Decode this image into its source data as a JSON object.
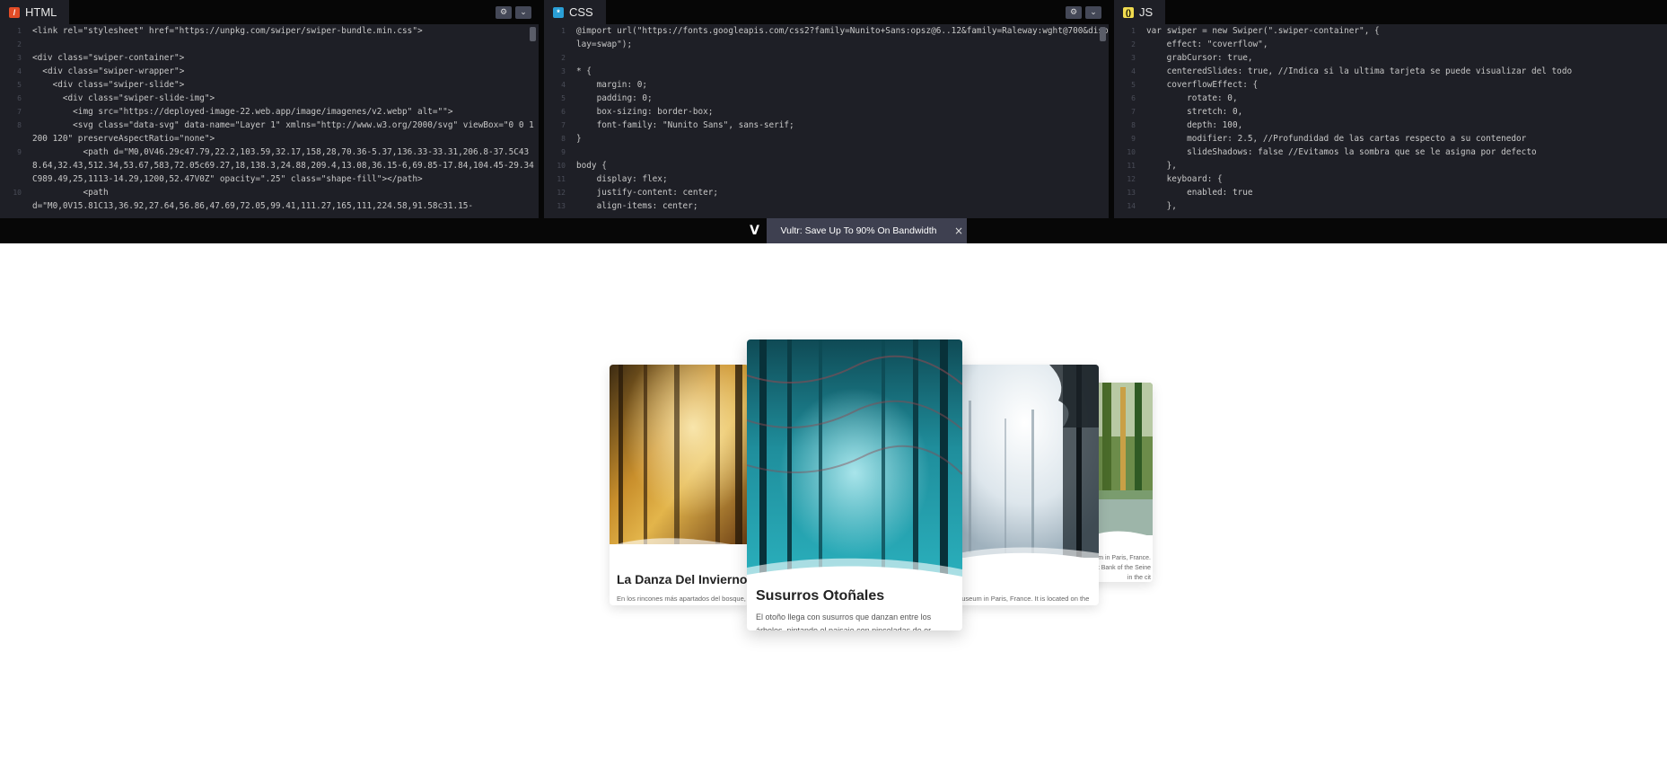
{
  "html_panel": {
    "tab_label": "HTML",
    "icon": "html-icon",
    "lines": [
      {
        "n": "1",
        "t": "<link rel=\"stylesheet\" href=\"https://unpkg.com/swiper/swiper-bundle.min.css\">"
      },
      {
        "n": "2",
        "t": ""
      },
      {
        "n": "3",
        "t": "<div class=\"swiper-container\">"
      },
      {
        "n": "4",
        "t": "  <div class=\"swiper-wrapper\">"
      },
      {
        "n": "5",
        "t": "    <div class=\"swiper-slide\">"
      },
      {
        "n": "6",
        "t": "      <div class=\"swiper-slide-img\">"
      },
      {
        "n": "7",
        "t": "        <img src=\"https://deployed-image-22.web.app/image/imagenes/v2.webp\" alt=\"\">"
      },
      {
        "n": "8",
        "t": "        <svg class=\"data-svg\" data-name=\"Layer 1\" xmlns=\"http://www.w3.org/2000/svg\" viewBox=\"0 0 1200 120\" preserveAspectRatio=\"none\">"
      },
      {
        "n": "9",
        "t": "          <path d=\"M0,0V46.29c47.79,22.2,103.59,32.17,158,28,70.36-5.37,136.33-33.31,206.8-37.5C438.64,32.43,512.34,53.67,583,72.05c69.27,18,138.3,24.88,209.4,13.08,36.15-6,69.85-17.84,104.45-29.34C989.49,25,1113-14.29,1200,52.47V0Z\" opacity=\".25\" class=\"shape-fill\"></path>"
      },
      {
        "n": "10",
        "t": "          <path"
      },
      {
        "n": "",
        "t": "d=\"M0,0V15.81C13,36.92,27.64,56.86,47.69,72.05,99.41,111.27,165,111,224.58,91.58c31.15-"
      }
    ]
  },
  "css_panel": {
    "tab_label": "CSS",
    "icon": "css-icon",
    "lines": [
      {
        "n": "1",
        "t": "@import url(\"https://fonts.googleapis.com/css2?family=Nunito+Sans:opsz@6..12&family=Raleway:wght@700&display=swap\");"
      },
      {
        "n": "2",
        "t": ""
      },
      {
        "n": "3",
        "t": "* {"
      },
      {
        "n": "4",
        "t": "    margin: 0;"
      },
      {
        "n": "5",
        "t": "    padding: 0;"
      },
      {
        "n": "6",
        "t": "    box-sizing: border-box;"
      },
      {
        "n": "7",
        "t": "    font-family: \"Nunito Sans\", sans-serif;"
      },
      {
        "n": "8",
        "t": "}"
      },
      {
        "n": "9",
        "t": ""
      },
      {
        "n": "10",
        "t": "body {"
      },
      {
        "n": "11",
        "t": "    display: flex;"
      },
      {
        "n": "12",
        "t": "    justify-content: center;"
      },
      {
        "n": "13",
        "t": "    align-items: center;"
      }
    ]
  },
  "js_panel": {
    "tab_label": "JS",
    "icon": "js-icon",
    "lines": [
      {
        "n": "1",
        "t": "var swiper = new Swiper(\".swiper-container\", {"
      },
      {
        "n": "2",
        "t": "    effect: \"coverflow\","
      },
      {
        "n": "3",
        "t": "    grabCursor: true,"
      },
      {
        "n": "4",
        "t": "    centeredSlides: true, //Indica si la ultima tarjeta se puede visualizar del todo"
      },
      {
        "n": "5",
        "t": "    coverflowEffect: {"
      },
      {
        "n": "6",
        "t": "        rotate: 0,"
      },
      {
        "n": "7",
        "t": "        stretch: 0,"
      },
      {
        "n": "8",
        "t": "        depth: 100,"
      },
      {
        "n": "9",
        "t": "        modifier: 2.5, //Profundidad de las cartas respecto a su contenedor"
      },
      {
        "n": "10",
        "t": "        slideShadows: false //Evitamos la sombra que se le asigna por defecto"
      },
      {
        "n": "11",
        "t": "    },"
      },
      {
        "n": "12",
        "t": "    keyboard: {"
      },
      {
        "n": "13",
        "t": "        enabled: true"
      },
      {
        "n": "14",
        "t": "    },"
      }
    ]
  },
  "ad": {
    "text": "Vultr: Save Up To 90% On Bandwidth",
    "close": "×",
    "logo": "V"
  },
  "cards": [
    {
      "title": "La Danza Del Invierno",
      "desc": "En los rincones más apartados del bosque, la naturaleza se prepara para recibir al invierno..."
    },
    {
      "title": "Susurros Otoñales",
      "desc": "El otoño llega con susurros que danzan entre los árboles, pintando el paisaje con pinceladas de or..."
    },
    {
      "title": "",
      "desc": "museum in Paris, France. It is located on the Right Bank of the Seine in the city's 1st..."
    },
    {
      "title": "",
      "desc": "um in Paris, France. Right Bank of the Seine in the cit"
    }
  ],
  "colors": {
    "html_icon": "#e34c26",
    "css_icon": "#2a9fd6",
    "js_icon": "#f0db4f",
    "ad_bg": "#3e4050"
  }
}
